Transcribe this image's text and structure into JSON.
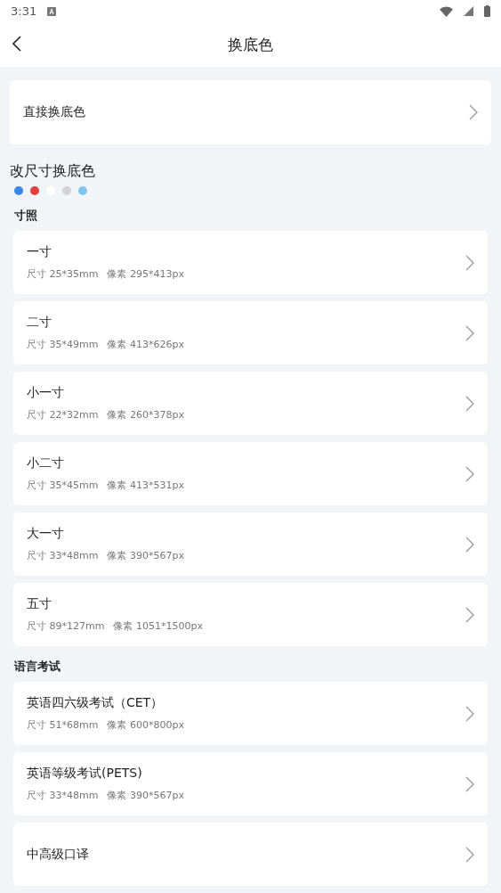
{
  "status_bar": {
    "time": "3:31"
  },
  "header": {
    "title": "换底色"
  },
  "direct": {
    "label": "直接换底色"
  },
  "resize": {
    "title": "改尺寸换底色",
    "colors": [
      {
        "color": "#3b87e8"
      },
      {
        "color": "#e0423b"
      },
      {
        "color": "#ffffff"
      },
      {
        "color": "#d3d3d5"
      },
      {
        "color": "#7fc6f5"
      }
    ]
  },
  "groups": [
    {
      "title": "寸照",
      "items": [
        {
          "name": "一寸",
          "size": "尺寸 25*35mm",
          "pixels": "像素 295*413px"
        },
        {
          "name": "二寸",
          "size": "尺寸 35*49mm",
          "pixels": "像素 413*626px"
        },
        {
          "name": "小一寸",
          "size": "尺寸 22*32mm",
          "pixels": "像素 260*378px"
        },
        {
          "name": "小二寸",
          "size": "尺寸 35*45mm",
          "pixels": "像素 413*531px"
        },
        {
          "name": "大一寸",
          "size": "尺寸 33*48mm",
          "pixels": "像素 390*567px"
        },
        {
          "name": "五寸",
          "size": "尺寸 89*127mm",
          "pixels": "像素 1051*1500px"
        }
      ]
    },
    {
      "title": "语言考试",
      "items": [
        {
          "name": "英语四六级考试（CET）",
          "size": "尺寸 51*68mm",
          "pixels": "像素 600*800px"
        },
        {
          "name": "英语等级考试(PETS)",
          "size": "尺寸 33*48mm",
          "pixels": "像素 390*567px"
        },
        {
          "name": "中高级口译"
        }
      ]
    }
  ]
}
